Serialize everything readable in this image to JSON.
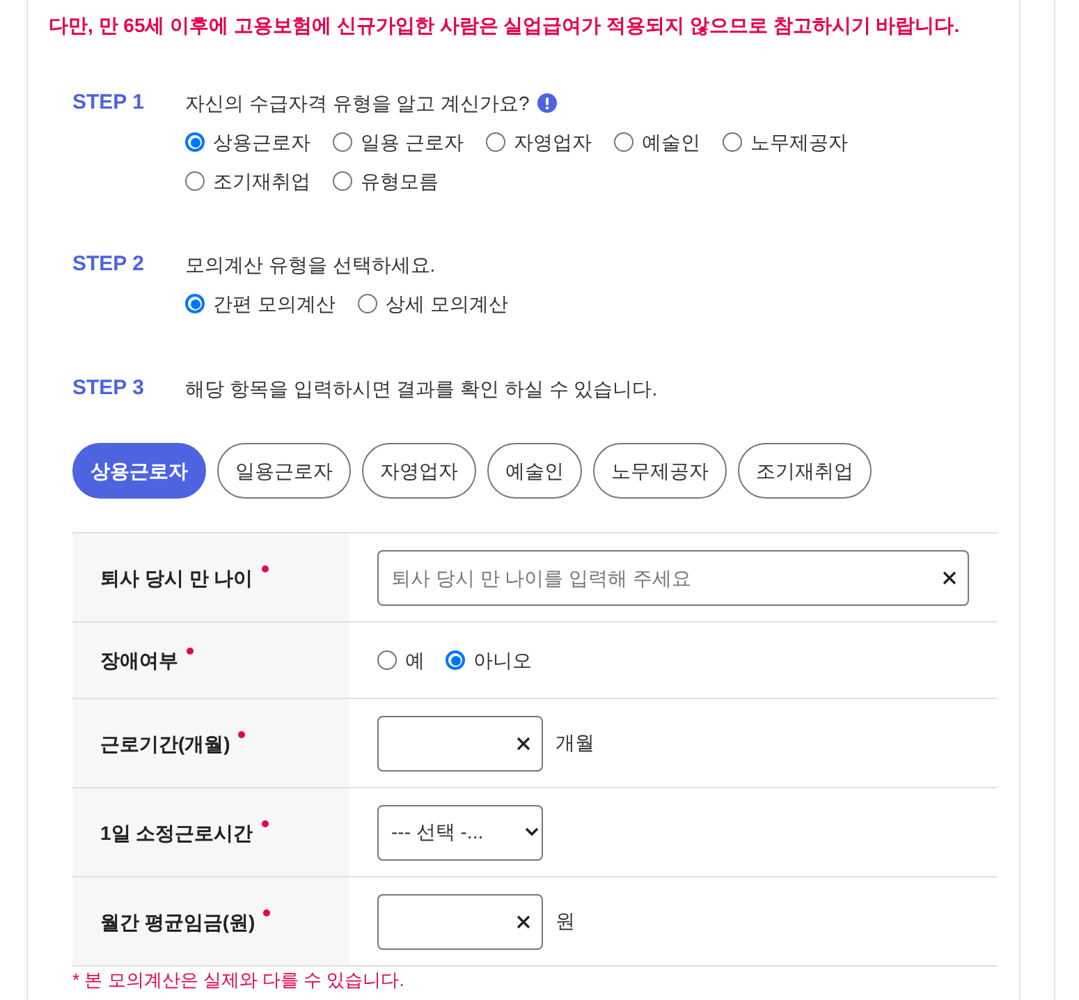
{
  "notice": "다만, 만 65세 이후에 고용보험에 신규가입한 사람은 실업급여가 적용되지 않으므로 참고하시기 바랍니다.",
  "steps": [
    {
      "label": "STEP 1",
      "question": "자신의 수급자격 유형을 알고 계신가요?",
      "info_icon": true,
      "options": [
        {
          "label": "상용근로자",
          "selected": true
        },
        {
          "label": "일용 근로자",
          "selected": false
        },
        {
          "label": "자영업자",
          "selected": false
        },
        {
          "label": "예술인",
          "selected": false
        },
        {
          "label": "노무제공자",
          "selected": false
        },
        {
          "label": "조기재취업",
          "selected": false
        },
        {
          "label": "유형모름",
          "selected": false
        }
      ]
    },
    {
      "label": "STEP 2",
      "question": "모의계산 유형을 선택하세요.",
      "info_icon": false,
      "options": [
        {
          "label": "간편 모의계산",
          "selected": true
        },
        {
          "label": "상세 모의계산",
          "selected": false
        }
      ]
    },
    {
      "label": "STEP 3",
      "question": "해당 항목을 입력하시면 결과를 확인 하실 수 있습니다.",
      "info_icon": false
    }
  ],
  "worker_tabs": [
    {
      "label": "상용근로자",
      "selected": true
    },
    {
      "label": "일용근로자",
      "selected": false
    },
    {
      "label": "자영업자",
      "selected": false
    },
    {
      "label": "예술인",
      "selected": false
    },
    {
      "label": "노무제공자",
      "selected": false
    },
    {
      "label": "조기재취업",
      "selected": false
    }
  ],
  "form": {
    "rows": [
      {
        "label": "퇴사 당시 만 나이",
        "required": true,
        "kind": "text",
        "placeholder": "퇴사 당시 만 나이를 입력해 주세요"
      },
      {
        "label": "장애여부",
        "required": true,
        "kind": "radio",
        "options": [
          {
            "label": "예",
            "selected": false
          },
          {
            "label": "아니오",
            "selected": true
          }
        ]
      },
      {
        "label": "근로기간(개월)",
        "required": true,
        "kind": "number",
        "unit": "개월"
      },
      {
        "label": "1일 소정근로시간",
        "required": true,
        "kind": "select",
        "value": "--- 선택 -..."
      },
      {
        "label": "월간 평균임금(원)",
        "required": true,
        "kind": "number",
        "unit": "원"
      }
    ]
  },
  "footnote": "* 본 모의계산은 실제와 다를 수 있습니다."
}
